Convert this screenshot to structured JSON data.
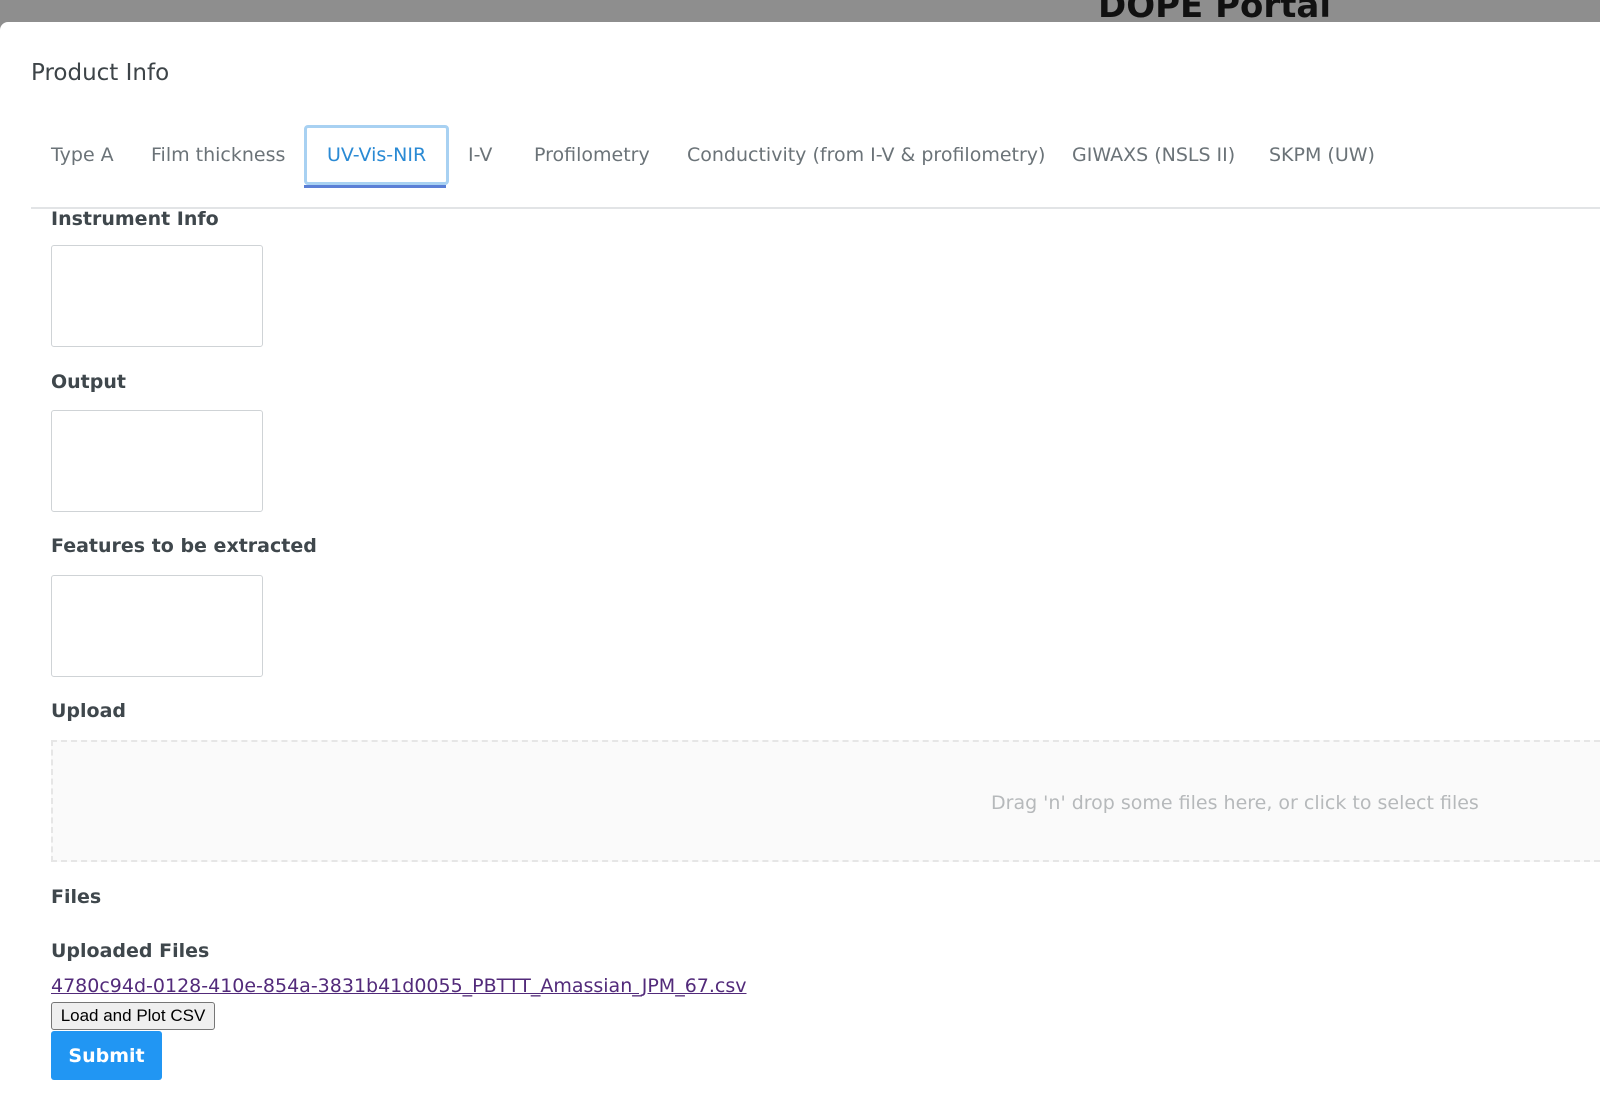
{
  "background": {
    "portal_title": "DOPE Portal"
  },
  "modal": {
    "title": "Product Info",
    "tabs": [
      {
        "label": "Type A",
        "active": false
      },
      {
        "label": "Film thickness",
        "active": false
      },
      {
        "label": "UV-Vis-NIR",
        "active": true
      },
      {
        "label": "I-V",
        "active": false
      },
      {
        "label": "Profilometry",
        "active": false
      },
      {
        "label": "Conductivity (from I-V & profilometry)",
        "active": false
      },
      {
        "label": "GIWAXS (NSLS II)",
        "active": false
      },
      {
        "label": "SKPM (UW)",
        "active": false
      }
    ],
    "fields": {
      "instrument_info": {
        "label": "Instrument Info",
        "value": ""
      },
      "output": {
        "label": "Output",
        "value": ""
      },
      "features": {
        "label": "Features to be extracted",
        "value": ""
      }
    },
    "upload": {
      "label": "Upload",
      "dropzone_text": "Drag 'n' drop some files here, or click to select files"
    },
    "files": {
      "label": "Files",
      "uploaded_label": "Uploaded Files",
      "items": [
        {
          "name": "4780c94d-0128-410e-854a-3831b41d0055_PBTTT_Amassian_JPM_67.csv"
        }
      ]
    },
    "load_plot_label": "Load and Plot CSV",
    "submit_label": "Submit"
  },
  "colors": {
    "accent": "#2196f3",
    "active_tab": "#2a8ad4",
    "link": "#522a7a"
  }
}
